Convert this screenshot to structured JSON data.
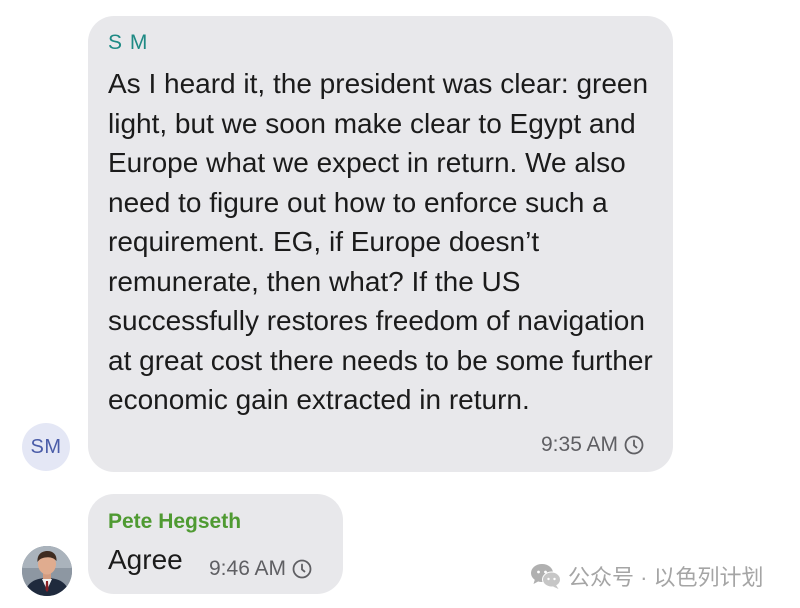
{
  "messages": [
    {
      "avatar": "SM",
      "sender": "S M",
      "text": "As I heard it, the president was clear: green light, but we soon make clear to Egypt and Europe what we expect in return. We also need to figure out how to enforce such a requirement. EG, if Europe doesn’t remunerate, then what? If the US successfully restores freedom of navigation at great cost there needs to be some further economic gain extracted in return.",
      "time": "9:35 AM",
      "status_icon": "clock-icon",
      "sender_color": "#1e8a84"
    },
    {
      "avatar": "profile-photo",
      "sender": "Pete Hegseth",
      "text": "Agree",
      "time": "9:46 AM",
      "status_icon": "clock-icon",
      "sender_color": "#4f9a32"
    }
  ],
  "watermark": {
    "icon": "wechat-icon",
    "text": "公众号 · 以色列计划"
  },
  "colors": {
    "bubble": "#e8e8eb",
    "avatar_bg": "#e4e7f5",
    "avatar_text": "#4a5ca8"
  }
}
